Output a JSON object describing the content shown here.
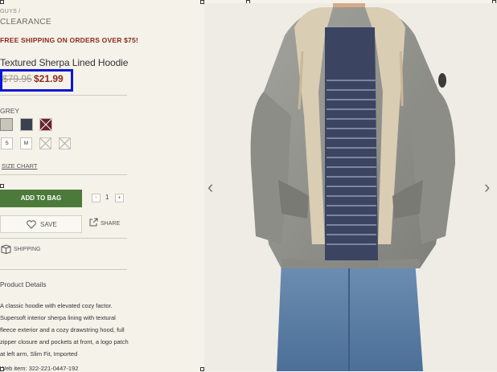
{
  "breadcrumb": {
    "parent": "GUYS  /",
    "current": "CLEARANCE"
  },
  "promo": "FREE SHIPPING ON ORDERS OVER $75!",
  "product": {
    "title": "Textured Sherpa Lined Hoodie",
    "old_price": "$79.95",
    "new_price": "$21.99"
  },
  "color_label": "GREY",
  "swatches": [
    {
      "name": "grey",
      "color": "#c9c5b8"
    },
    {
      "name": "navy",
      "color": "#3a4150"
    },
    {
      "name": "burgundy",
      "color": "#6a2230"
    }
  ],
  "sizes": [
    "S",
    "M"
  ],
  "size_chart": "SIZE CHART",
  "add_to_bag": "ADD TO BAG",
  "quantity": {
    "minus": "-",
    "value": "1",
    "plus": "+"
  },
  "save": "SAVE",
  "share": "SHARE",
  "shipping": "SHIPPING",
  "details_heading": "Product Details",
  "description": "A classic hoodie with elevated cozy factor. Supersoft interior sherpa lining with textural fleece exterior and a cozy drawstring hood, full zipper closure and pockets at front, a logo patch at left arm, Slim Fit, Imported",
  "cut_text": "Web item: 322-221-0447-192",
  "colors": {
    "accent_red": "#8c2a1c",
    "add_green": "#4b7a3b",
    "highlight_blue": "#0a16d6"
  },
  "icons": [
    "heart-icon",
    "share-icon",
    "shipping-box-icon",
    "chevron-left-icon",
    "chevron-right-icon"
  ]
}
